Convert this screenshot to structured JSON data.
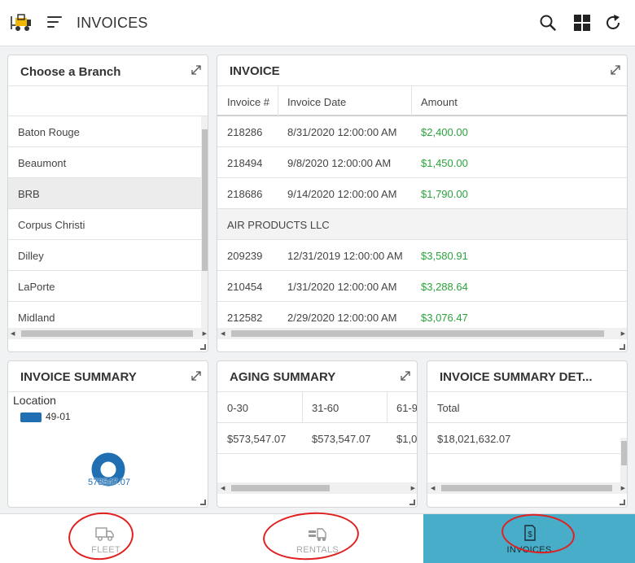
{
  "header": {
    "title": "INVOICES",
    "icons": [
      "forklift-logo",
      "menu-icon",
      "search-icon",
      "grid-icon",
      "refresh-icon"
    ]
  },
  "branch_panel": {
    "title": "Choose a Branch",
    "branches": [
      "Baton Rouge",
      "Beaumont",
      "BRB",
      "Corpus Christi",
      "Dilley",
      "LaPorte",
      "Midland"
    ],
    "selected": "BRB"
  },
  "invoice_panel": {
    "title": "INVOICE",
    "columns": [
      "Invoice #",
      "Invoice Date",
      "Amount"
    ],
    "rows": [
      {
        "invoice": "218286",
        "date": "8/31/2020 12:00:00 AM",
        "amount": "$2,400.00"
      },
      {
        "invoice": "218494",
        "date": "9/8/2020 12:00:00 AM",
        "amount": "$1,450.00"
      },
      {
        "invoice": "218686",
        "date": "9/14/2020 12:00:00 AM",
        "amount": "$1,790.00"
      },
      {
        "group": "AIR PRODUCTS LLC"
      },
      {
        "invoice": "209239",
        "date": "12/31/2019 12:00:00 AM",
        "amount": "$3,580.91"
      },
      {
        "invoice": "210454",
        "date": "1/31/2020 12:00:00 AM",
        "amount": "$3,288.64"
      },
      {
        "invoice": "212582",
        "date": "2/29/2020 12:00:00 AM",
        "amount": "$3,076.47"
      }
    ]
  },
  "summary_panel": {
    "title": "INVOICE SUMMARY",
    "legend_title": "Location",
    "legend_item": "49-01",
    "donut_value": "573547.07",
    "legend_color": "#1f6fb2"
  },
  "aging_panel": {
    "title": "AGING SUMMARY",
    "columns": [
      "0-30",
      "31-60",
      "61-9"
    ],
    "values": [
      "$573,547.07",
      "$573,547.07",
      "$1,0"
    ]
  },
  "detail_panel": {
    "title": "INVOICE SUMMARY DET...",
    "column": "Total",
    "value": "$18,021,632.07"
  },
  "bottom_nav": {
    "items": [
      "FLEET",
      "RENTALS",
      "INVOICES"
    ],
    "active": "INVOICES",
    "active_color": "#47adc8"
  },
  "colors": {
    "amount": "#2ba33c",
    "selected_row": "#ececec",
    "annotation": "#e02020"
  }
}
